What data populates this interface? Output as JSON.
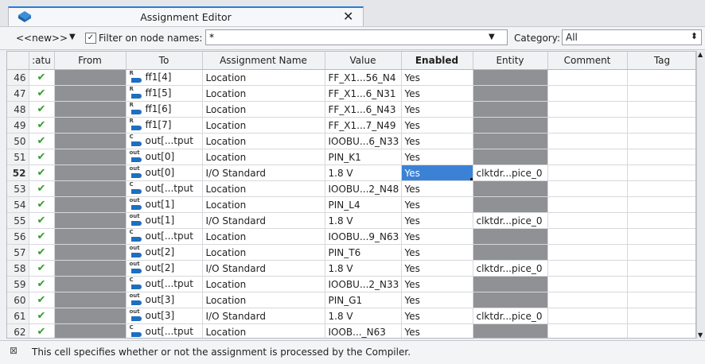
{
  "tab": {
    "title": "Assignment Editor",
    "close": "✕"
  },
  "toolbar": {
    "node_selector": "<<new>>",
    "filter_label": "Filter on node names:",
    "filter_value": "*",
    "category_label": "Category:",
    "category_value": "All"
  },
  "table": {
    "columns": [
      ":atu",
      "From",
      "To",
      "Assignment Name",
      "Value",
      "Enabled",
      "Entity",
      "Comment",
      "Tag"
    ],
    "rows": [
      {
        "num": "46",
        "icon": "R",
        "to": "ff1[4]",
        "name": "Location",
        "value": "FF_X1...56_N4",
        "enabled": "Yes",
        "entity": ""
      },
      {
        "num": "47",
        "icon": "R",
        "to": "ff1[5]",
        "name": "Location",
        "value": "FF_X1...6_N31",
        "enabled": "Yes",
        "entity": ""
      },
      {
        "num": "48",
        "icon": "R",
        "to": "ff1[6]",
        "name": "Location",
        "value": "FF_X1...6_N43",
        "enabled": "Yes",
        "entity": ""
      },
      {
        "num": "49",
        "icon": "R",
        "to": "ff1[7]",
        "name": "Location",
        "value": "FF_X1...7_N49",
        "enabled": "Yes",
        "entity": ""
      },
      {
        "num": "50",
        "icon": "C",
        "to": "out[...tput",
        "name": "Location",
        "value": "IOOBU...6_N33",
        "enabled": "Yes",
        "entity": ""
      },
      {
        "num": "51",
        "icon": "out",
        "to": "out[0]",
        "name": "Location",
        "value": "PIN_K1",
        "enabled": "Yes",
        "entity": ""
      },
      {
        "num": "52",
        "icon": "out",
        "to": "out[0]",
        "name": "I/O Standard",
        "value": "1.8 V",
        "enabled": "Yes",
        "entity": "clktdr...pice_0"
      },
      {
        "num": "53",
        "icon": "C",
        "to": "out[...tput",
        "name": "Location",
        "value": "IOOBU...2_N48",
        "enabled": "Yes",
        "entity": ""
      },
      {
        "num": "54",
        "icon": "out",
        "to": "out[1]",
        "name": "Location",
        "value": "PIN_L4",
        "enabled": "Yes",
        "entity": ""
      },
      {
        "num": "55",
        "icon": "out",
        "to": "out[1]",
        "name": "I/O Standard",
        "value": "1.8 V",
        "enabled": "Yes",
        "entity": "clktdr...pice_0"
      },
      {
        "num": "56",
        "icon": "C",
        "to": "out[...tput",
        "name": "Location",
        "value": "IOOBU...9_N63",
        "enabled": "Yes",
        "entity": ""
      },
      {
        "num": "57",
        "icon": "out",
        "to": "out[2]",
        "name": "Location",
        "value": "PIN_T6",
        "enabled": "Yes",
        "entity": ""
      },
      {
        "num": "58",
        "icon": "out",
        "to": "out[2]",
        "name": "I/O Standard",
        "value": "1.8 V",
        "enabled": "Yes",
        "entity": "clktdr...pice_0"
      },
      {
        "num": "59",
        "icon": "C",
        "to": "out[...tput",
        "name": "Location",
        "value": "IOOBU...2_N33",
        "enabled": "Yes",
        "entity": ""
      },
      {
        "num": "60",
        "icon": "out",
        "to": "out[3]",
        "name": "Location",
        "value": "PIN_G1",
        "enabled": "Yes",
        "entity": ""
      },
      {
        "num": "61",
        "icon": "out",
        "to": "out[3]",
        "name": "I/O Standard",
        "value": "1.8 V",
        "enabled": "Yes",
        "entity": "clktdr...pice_0"
      },
      {
        "num": "62",
        "icon": "C",
        "to": "out[...tput",
        "name": "Location",
        "value": "IOOB..._N63",
        "enabled": "Yes",
        "entity": ""
      }
    ],
    "selected_row": "52"
  },
  "status": {
    "text": "This cell specifies whether or not the assignment is processed by the Compiler."
  }
}
